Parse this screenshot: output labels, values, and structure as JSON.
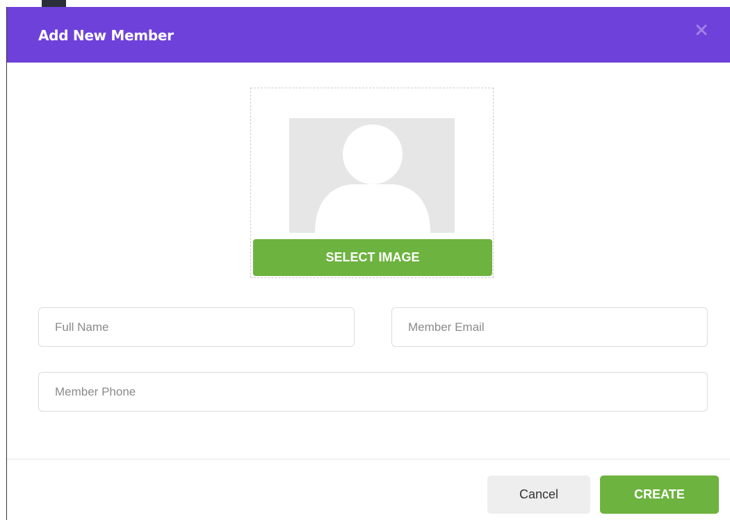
{
  "modal": {
    "title": "Add New Member",
    "close_icon": "close-icon"
  },
  "image_picker": {
    "avatar_icon": "user-silhouette-icon",
    "select_label": "SELECT IMAGE"
  },
  "form": {
    "full_name": {
      "placeholder": "Full Name",
      "value": ""
    },
    "email": {
      "placeholder": "Member Email",
      "value": ""
    },
    "phone": {
      "placeholder": "Member Phone",
      "value": ""
    }
  },
  "footer": {
    "cancel_label": "Cancel",
    "create_label": "CREATE"
  },
  "colors": {
    "header": "#6e41db",
    "primary_button": "#6db33f",
    "cancel_button": "#eeeeee"
  }
}
